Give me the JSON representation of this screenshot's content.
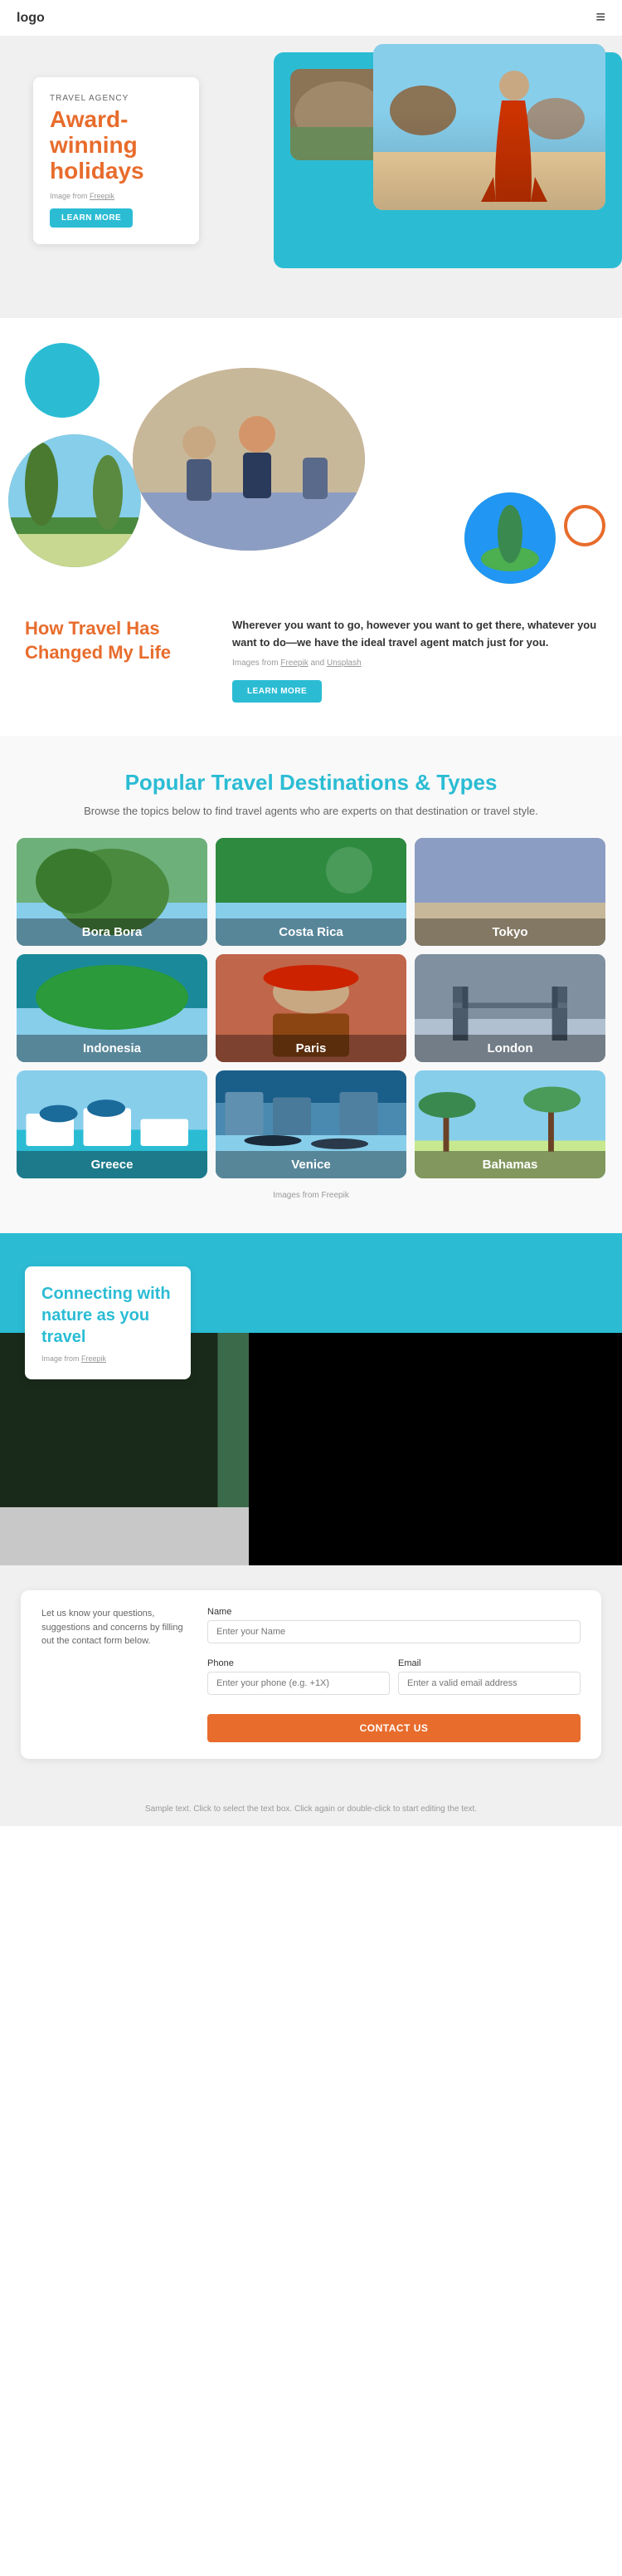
{
  "header": {
    "logo": "logo",
    "hamburger_icon": "≡"
  },
  "hero": {
    "label": "TRAVEL AGENCY",
    "title": "Award-winning holidays",
    "image_credit_text": "Image from ",
    "image_credit_link": "Freepik",
    "learn_more_button": "LEARN MORE"
  },
  "circles": {
    "decorative": true
  },
  "travel_changed": {
    "title": "How Travel Has Changed My Life",
    "description": "Wherever you want to go, however you want to get there, whatever you want to do—we have the ideal travel agent match just for you.",
    "credit_text": "Images from ",
    "credit_link1": "Freepik",
    "credit_link2": "Unsplash",
    "learn_more_button": "LEARN MORE"
  },
  "destinations": {
    "title": "Popular Travel Destinations & Types",
    "subtitle": "Browse the topics below to find travel agents who are experts on that destination or travel style.",
    "credit_text": "Images from Freepik",
    "cards": [
      {
        "id": "bora-bora",
        "label": "Bora Bora",
        "class": "dest-bora-bora"
      },
      {
        "id": "costa-rica",
        "label": "Costa Rica",
        "class": "dest-costa-rica"
      },
      {
        "id": "tokyo",
        "label": "Tokyo",
        "class": "dest-tokyo"
      },
      {
        "id": "indonesia",
        "label": "Indonesia",
        "class": "dest-indonesia"
      },
      {
        "id": "paris",
        "label": "Paris",
        "class": "dest-paris"
      },
      {
        "id": "london",
        "label": "London",
        "class": "dest-london"
      },
      {
        "id": "greece",
        "label": "Greece",
        "class": "dest-greece"
      },
      {
        "id": "venice",
        "label": "Venice",
        "class": "dest-venice"
      },
      {
        "id": "bahamas",
        "label": "Bahamas",
        "class": "dest-bahamas"
      }
    ]
  },
  "nature": {
    "title": "Connecting with nature as you travel",
    "credit_text": "Image from ",
    "credit_link": "Freepik"
  },
  "contact": {
    "left_text": "Let us know your questions, suggestions and concerns by filling out the contact form below.",
    "name_label": "Name",
    "name_placeholder": "Enter your Name",
    "phone_label": "Phone",
    "phone_placeholder": "Enter your phone (e.g. +1X)",
    "email_label": "Email",
    "email_placeholder": "Enter a valid email address",
    "submit_button": "CONTACT US"
  },
  "footer": {
    "note": "Sample text. Click to select the text box. Click again or double-click to start editing the text."
  }
}
